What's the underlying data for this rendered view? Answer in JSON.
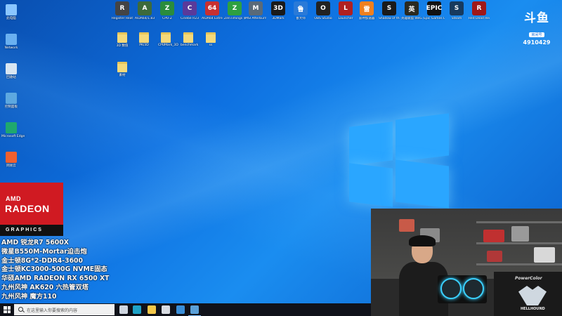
{
  "desktop": {
    "left_icons": [
      {
        "label": "此电脑",
        "icon": "computer-icon",
        "color": "#8ac6ff"
      },
      {
        "label": "Network",
        "icon": "network-icon",
        "color": "#6ab0f0"
      },
      {
        "label": "回收站",
        "icon": "recycle-bin-icon",
        "color": "#d8e6f2"
      },
      {
        "label": "控制面板",
        "icon": "control-panel-icon",
        "color": "#5da8e0"
      },
      {
        "label": "Microsoft Edge",
        "icon": "edge-icon",
        "color": "#1fa86e"
      },
      {
        "label": "网易云",
        "icon": "app-icon",
        "color": "#f06030"
      }
    ],
    "top_icons": [
      {
        "label": "Register Reatools",
        "icon": "register-icon",
        "color": "#444444",
        "glyph": "R"
      },
      {
        "label": "AIDA64/1.83",
        "icon": "aida-icon",
        "color": "#3d6a3a",
        "glyph": "A"
      },
      {
        "label": "CPU-Z",
        "icon": "cpuz-icon",
        "color": "#2a8c3c",
        "glyph": "Z"
      },
      {
        "label": "Cinebe R23",
        "icon": "cinebench-icon",
        "color": "#5a3a9a",
        "glyph": "C"
      },
      {
        "label": "AIDA64 Extreme",
        "icon": "aida64-icon",
        "color": "#c83030",
        "glyph": "64"
      },
      {
        "label": "ZenTimings 同学会",
        "icon": "zentimings-icon",
        "color": "#2ea040",
        "glyph": "Z"
      },
      {
        "label": "MSI Afterburner",
        "icon": "afterburner-icon",
        "color": "#5a6a78",
        "glyph": "M"
      },
      {
        "label": "3DMark",
        "icon": "3dmark-icon",
        "color": "#1a1a1a",
        "glyph": "3D"
      },
      {
        "label": "鲁大师",
        "icon": "ludashi-icon",
        "color": "#2a7ad8",
        "glyph": "鲁"
      },
      {
        "label": "OBS Studio",
        "icon": "obs-icon",
        "color": "#222222",
        "glyph": "O"
      },
      {
        "label": "Launcher",
        "icon": "launcher-icon",
        "color": "#b02020",
        "glyph": "L"
      },
      {
        "label": "雷神加速器",
        "icon": "leishen-icon",
        "color": "#f08020",
        "glyph": "雷"
      },
      {
        "label": "Shadow of the Tom...",
        "icon": "tomb-raider-icon",
        "color": "#1a1a1a",
        "glyph": "S"
      },
      {
        "label": "英雄联盟 WeGame版",
        "icon": "lol-icon",
        "color": "#2a2a20",
        "glyph": "英"
      },
      {
        "label": "Epic Games Launcher",
        "icon": "epic-icon",
        "color": "#111111",
        "glyph": "EPIC"
      },
      {
        "label": "Steam",
        "icon": "steam-icon",
        "color": "#173a5e",
        "glyph": "S"
      },
      {
        "label": "Red Dead Redempti...",
        "icon": "rdr2-icon",
        "color": "#a01818",
        "glyph": "R"
      }
    ],
    "folders": [
      {
        "label": "3D 数值"
      },
      {
        "label": "PK/3D"
      },
      {
        "label": "CPUMark_3D"
      },
      {
        "label": "benchmark"
      },
      {
        "label": "ss"
      },
      {
        "label": "素材"
      }
    ]
  },
  "stream": {
    "logo_text": "斗鱼",
    "room_label": "房间号",
    "room_number": "4910429"
  },
  "amd_badge": {
    "brand": "AMD",
    "product": "RADEON",
    "sub": "GRAPHICS"
  },
  "specs": [
    "AMD 锐龙R7 5600X",
    "微星B550M-Mortar迫击炮",
    "金士顿8G*2-DDR4-3600",
    "金士顿KC3000-500G NVME固态",
    "华硕AMD RADEON RX 6500 XT",
    "九州风神 AK620 六热管双塔",
    "九州风神 魔方110"
  ],
  "webcam": {
    "box_brand": "PowerColor",
    "box_model": "HELLHOUND"
  },
  "taskbar": {
    "search_placeholder": "在这里输入你要搜索的内容",
    "pinned": [
      {
        "icon": "task-view-icon",
        "color": "#cfd6e0"
      },
      {
        "icon": "edge-icon",
        "color": "#1fa3c8"
      },
      {
        "icon": "file-explorer-icon",
        "color": "#f4c84a"
      },
      {
        "icon": "store-icon",
        "color": "#d8dce2"
      },
      {
        "icon": "mail-icon",
        "color": "#3a8ed8"
      },
      {
        "icon": "steam-icon",
        "color": "#5aa0d8"
      }
    ]
  }
}
